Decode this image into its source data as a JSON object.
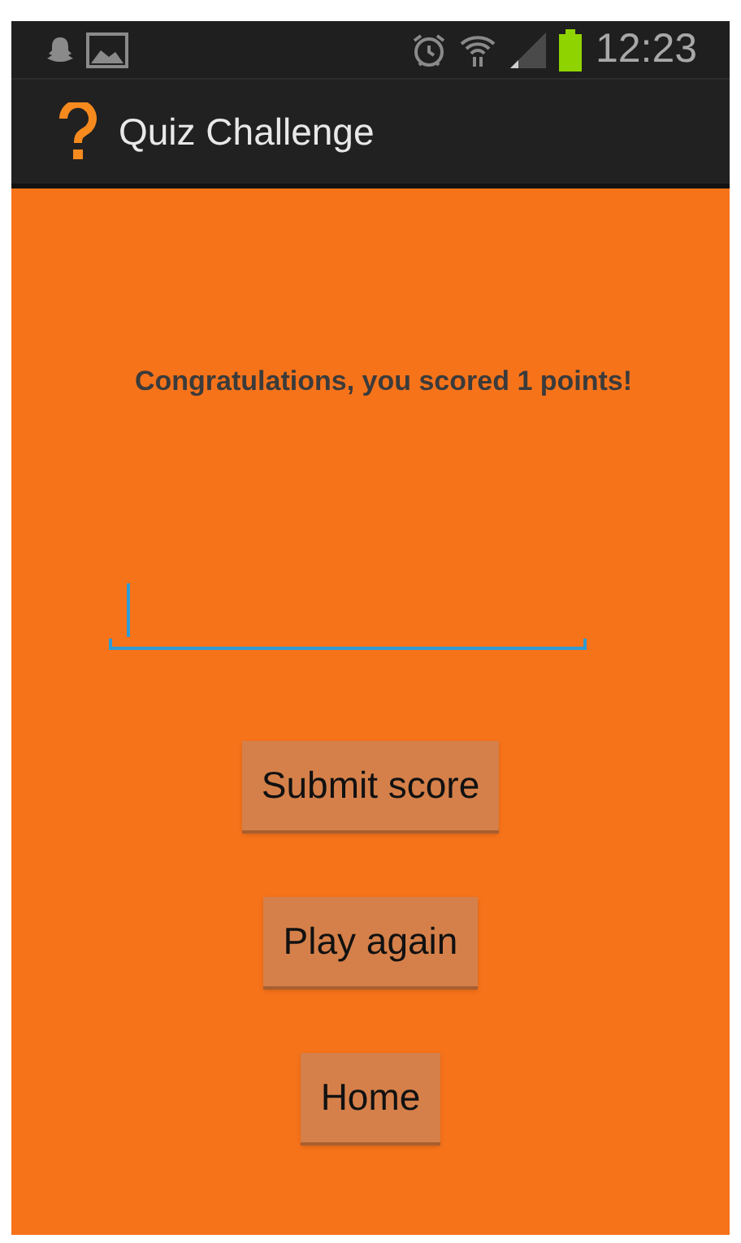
{
  "status_bar": {
    "time": "12:23"
  },
  "action_bar": {
    "title": "Quiz Challenge"
  },
  "message": "Congratulations, you scored 1 points!",
  "name_field": {
    "focused": true
  },
  "buttons": [
    "Submit score",
    "Play again",
    "Home"
  ]
}
